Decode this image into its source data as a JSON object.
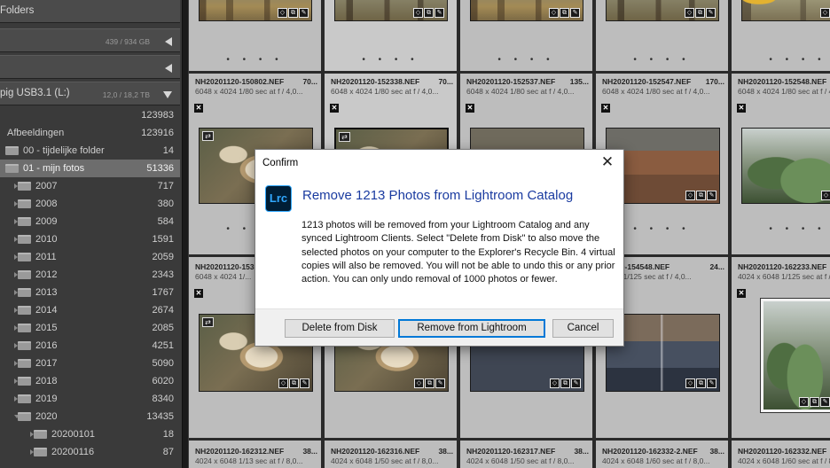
{
  "left_panel": {
    "folders_header": "Folders",
    "volume1": {
      "usage": "439 / 934 GB"
    },
    "volume3": {
      "name": "pig USB3.1 (L:)",
      "usage": "12,0 / 18,2 TB"
    },
    "root_count": "123983",
    "rows": [
      {
        "name": "Afbeeldingen",
        "count": "123916",
        "indent": 8,
        "icon": "none",
        "arrow": "none",
        "selected": false
      },
      {
        "name": "00 - tijdelijke folder",
        "count": "14",
        "indent": 26,
        "icon": "folder",
        "arrow": "none",
        "selected": false
      },
      {
        "name": "01 - mijn fotos",
        "count": "51336",
        "indent": 26,
        "icon": "folder",
        "arrow": "none",
        "selected": true
      },
      {
        "name": "2007",
        "count": "717",
        "indent": 40,
        "icon": "folder",
        "arrow": "right",
        "selected": false
      },
      {
        "name": "2008",
        "count": "380",
        "indent": 40,
        "icon": "folder",
        "arrow": "right",
        "selected": false
      },
      {
        "name": "2009",
        "count": "584",
        "indent": 40,
        "icon": "folder",
        "arrow": "right",
        "selected": false
      },
      {
        "name": "2010",
        "count": "1591",
        "indent": 40,
        "icon": "folder",
        "arrow": "right",
        "selected": false
      },
      {
        "name": "2011",
        "count": "2059",
        "indent": 40,
        "icon": "folder",
        "arrow": "right",
        "selected": false
      },
      {
        "name": "2012",
        "count": "2343",
        "indent": 40,
        "icon": "folder",
        "arrow": "right",
        "selected": false
      },
      {
        "name": "2013",
        "count": "1767",
        "indent": 40,
        "icon": "folder",
        "arrow": "right",
        "selected": false
      },
      {
        "name": "2014",
        "count": "2674",
        "indent": 40,
        "icon": "folder",
        "arrow": "right",
        "selected": false
      },
      {
        "name": "2015",
        "count": "2085",
        "indent": 40,
        "icon": "folder",
        "arrow": "right",
        "selected": false
      },
      {
        "name": "2016",
        "count": "4251",
        "indent": 40,
        "icon": "folder",
        "arrow": "right",
        "selected": false
      },
      {
        "name": "2017",
        "count": "5090",
        "indent": 40,
        "icon": "folder",
        "arrow": "right",
        "selected": false
      },
      {
        "name": "2018",
        "count": "6020",
        "indent": 40,
        "icon": "folder",
        "arrow": "right",
        "selected": false
      },
      {
        "name": "2019",
        "count": "8340",
        "indent": 40,
        "icon": "folder",
        "arrow": "right",
        "selected": false
      },
      {
        "name": "2020",
        "count": "13435",
        "indent": 40,
        "icon": "folder",
        "arrow": "down",
        "selected": false
      },
      {
        "name": "20200101",
        "count": "18",
        "indent": 58,
        "icon": "folder",
        "arrow": "right",
        "selected": false
      },
      {
        "name": "20200116",
        "count": "87",
        "indent": 58,
        "icon": "folder",
        "arrow": "right",
        "selected": false
      }
    ]
  },
  "grid": {
    "badges": [
      "◇",
      "⧉",
      "✎"
    ],
    "virtual_copy_glyph": "⇄",
    "reject_glyph": "✕",
    "dots": "• • • •",
    "rows": [
      {
        "cells": [
          {
            "file": "NH20201120-150802.NEF",
            "size": "70...",
            "meta": "6048 x 4024   1/80 sec at f / 4,0...",
            "image": "img-forest",
            "vc": false
          },
          {
            "file": "NH20201120-152338.NEF",
            "size": "70...",
            "meta": "6048 x 4024   1/80 sec at f / 4,0...",
            "image": "img-forest2",
            "vc": true
          },
          {
            "file": "NH20201120-152537.NEF",
            "size": "135...",
            "meta": "6048 x 4024   1/80 sec at f / 4,0...",
            "image": "img-forest",
            "vc": true
          },
          {
            "file": "NH20201120-152547.NEF",
            "size": "170...",
            "meta": "6048 x 4024   1/80 sec at f / 4,0...",
            "image": "img-forest2",
            "vc": true
          },
          {
            "file": "NH20201120-152548.NEF",
            "size": "",
            "meta": "6048 x 4024   1/80 sec at f / 4,0...",
            "image": "img-leaf",
            "vc": true
          }
        ]
      },
      {
        "cells": [
          {
            "file": "NH20201120-153...",
            "size": "",
            "meta": "6048 x 4024   1/...",
            "image": "img-fungus",
            "vc": true
          },
          {
            "file": "",
            "size": "",
            "meta": "",
            "image": "img-fungus",
            "vc": true
          },
          {
            "file": "",
            "size": "",
            "meta": "",
            "image": "img-water",
            "vc": false
          },
          {
            "file": "...1120-154548.NEF",
            "size": "24...",
            "meta": "...024   1/125 sec at f / 4,0...",
            "image": "img-ground",
            "vc": false
          },
          {
            "file": "NH20201120-162233.NEF",
            "size": "",
            "meta": "4024 x 6048   1/125 sec at f / 4,0...",
            "image": "img-green",
            "vc": false
          }
        ]
      },
      {
        "cells": [
          {
            "file": "NH20201120-162312.NEF",
            "size": "38...",
            "meta": "4024 x 6048   1/13 sec at f / 8,0...",
            "image": "",
            "vc": false
          },
          {
            "file": "NH20201120-162316.NEF",
            "size": "38...",
            "meta": "4024 x 6048   1/50 sec at f / 8,0...",
            "image": "",
            "vc": false
          },
          {
            "file": "NH20201120-162317.NEF",
            "size": "38...",
            "meta": "4024 x 6048   1/50 sec at f / 8,0...",
            "image": "",
            "vc": false
          },
          {
            "file": "NH20201120-162332-2.NEF",
            "size": "38...",
            "meta": "4024 x 6048   1/60 sec at f / 8,0...",
            "image": "",
            "vc": false
          },
          {
            "file": "NH20201120-162332.NEF",
            "size": "",
            "meta": "4024 x 6048   1/60 sec at f / 8,0...",
            "image": "",
            "vc": false
          }
        ]
      }
    ]
  },
  "dialog": {
    "title": "Confirm",
    "close_glyph": "✕",
    "logo_text": "Lrc",
    "heading": "Remove 1213 Photos from Lightroom Catalog",
    "message": "1213 photos will be removed from your Lightroom Catalog and any synced Lightroom Clients. Select \"Delete from Disk\" to also move the selected photos on your computer to the Explorer's Recycle Bin.  4 virtual copies will also be removed.  You will not be able to undo this or any prior action.  You can only undo removal of 1000 photos or fewer.",
    "buttons": {
      "delete": "Delete from Disk",
      "remove": "Remove from Lightroom",
      "cancel": "Cancel"
    }
  }
}
